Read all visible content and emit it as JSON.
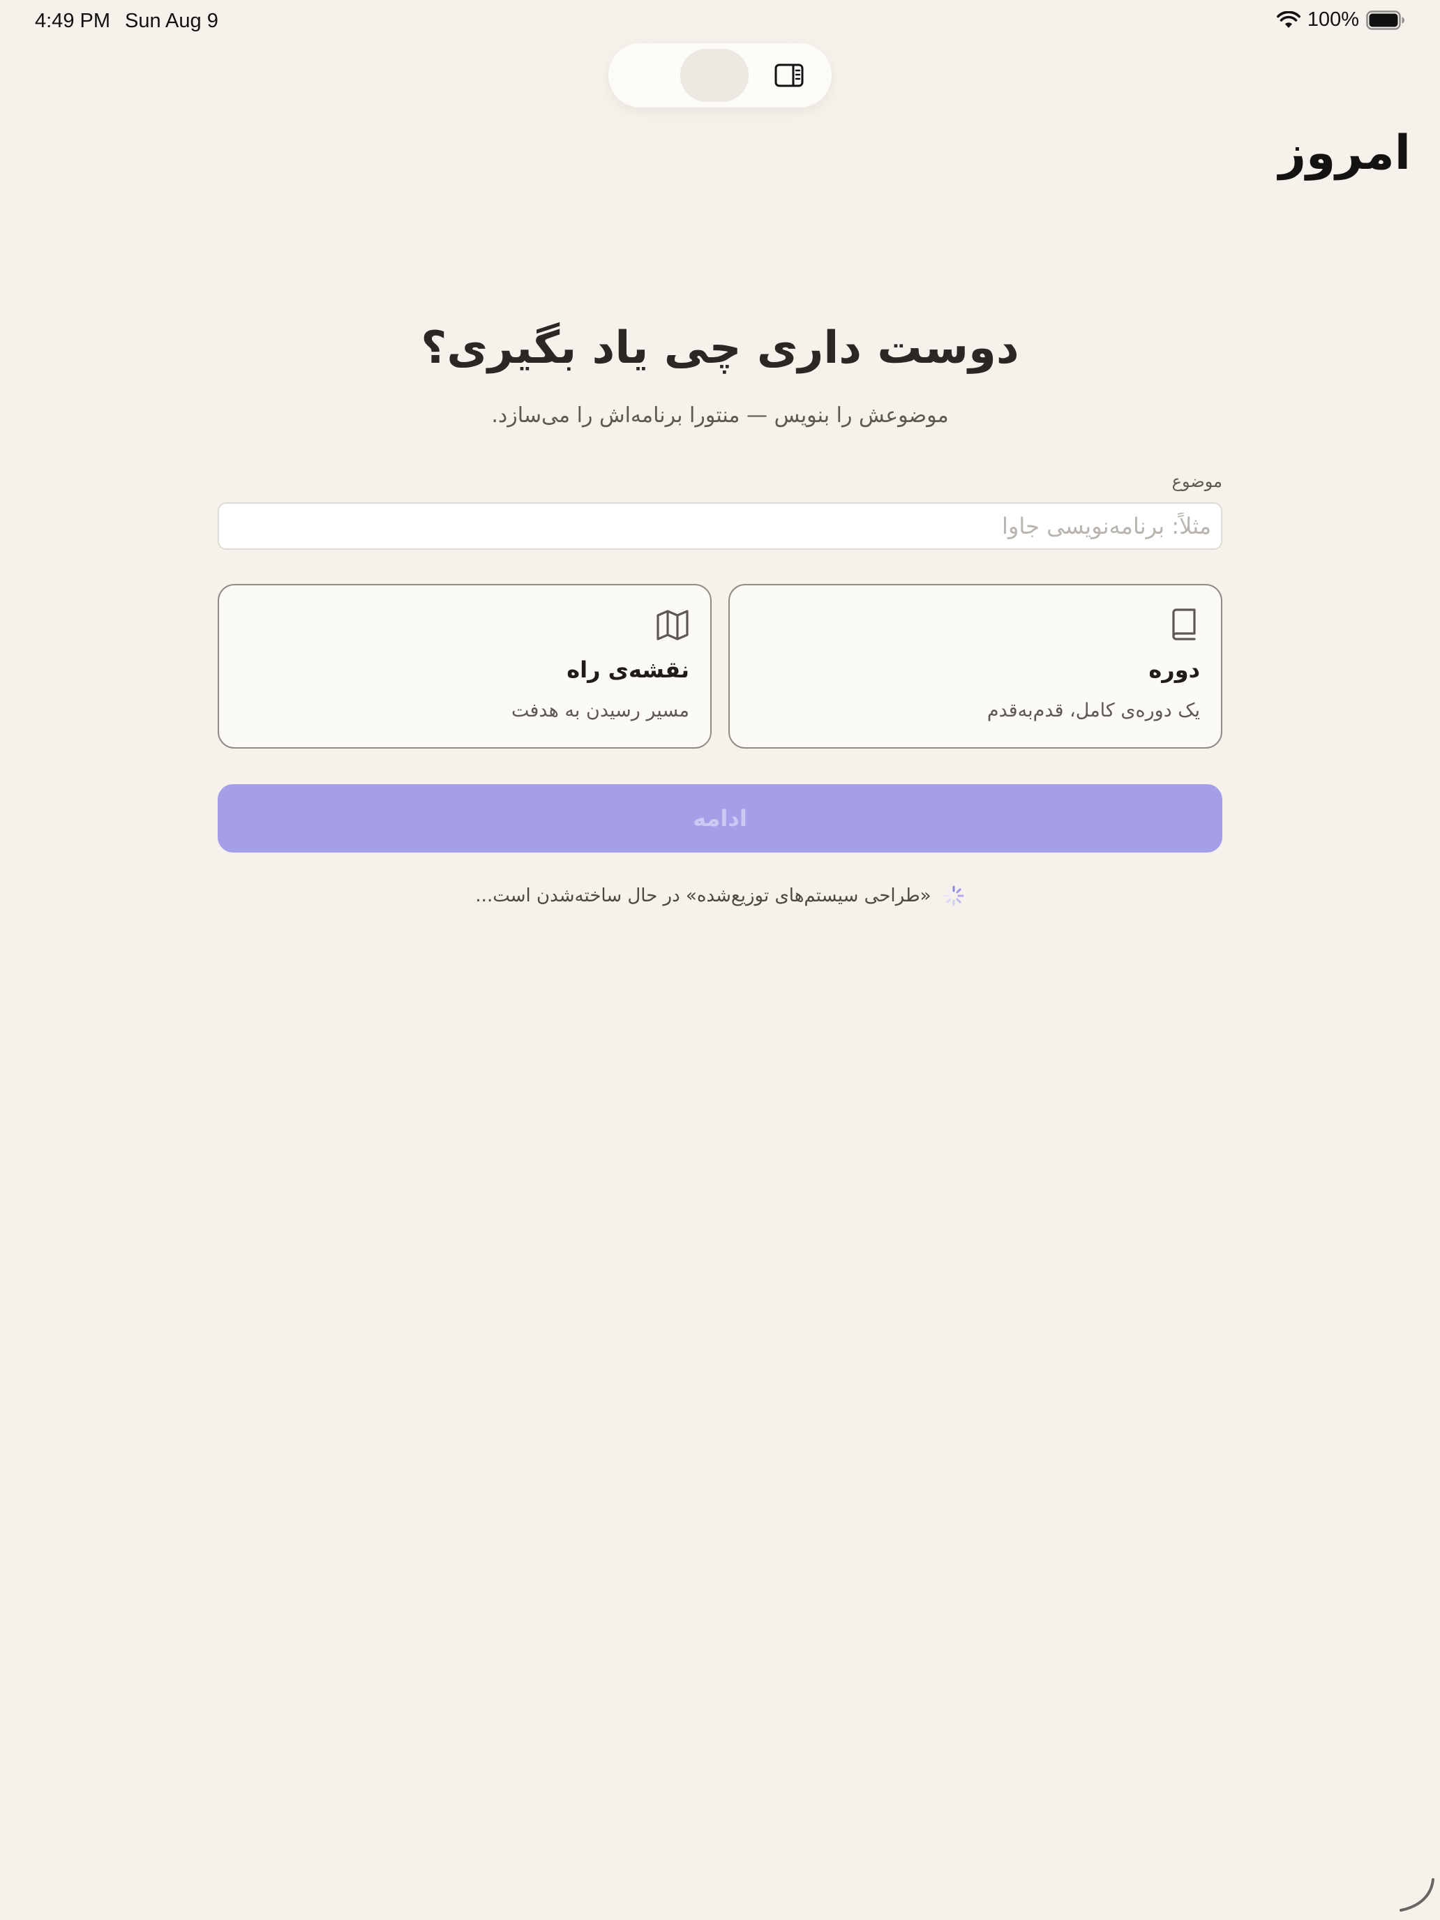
{
  "status_bar": {
    "time": "4:49 PM",
    "date": "Sun Aug 9",
    "battery": "100%"
  },
  "header": {
    "title": "امروز"
  },
  "main": {
    "heading": "دوست داری چی یاد بگیری؟",
    "subtitle": "موضوعش را بنویس — منتورا برنامه‌اش را می‌سازد."
  },
  "topic": {
    "label": "موضوع",
    "value": "",
    "placeholder": "مثلاً: برنامه‌نویسی جاوا"
  },
  "options": [
    {
      "icon": "book-icon",
      "title": "دوره",
      "description": "یک دوره‌ی کامل، قدم‌به‌قدم"
    },
    {
      "icon": "map-icon",
      "title": "نقشه‌ی راه",
      "description": "مسیر رسیدن به هدفت"
    }
  ],
  "continue_button": {
    "label": "ادامه"
  },
  "loading": {
    "text": "«طراحی سیستم‌های توزیع‌شده» در حال ساخته‌شدن است..."
  },
  "colors": {
    "background": "#f6f2eb",
    "accent": "#a59fe8",
    "card_border": "#928b84"
  }
}
